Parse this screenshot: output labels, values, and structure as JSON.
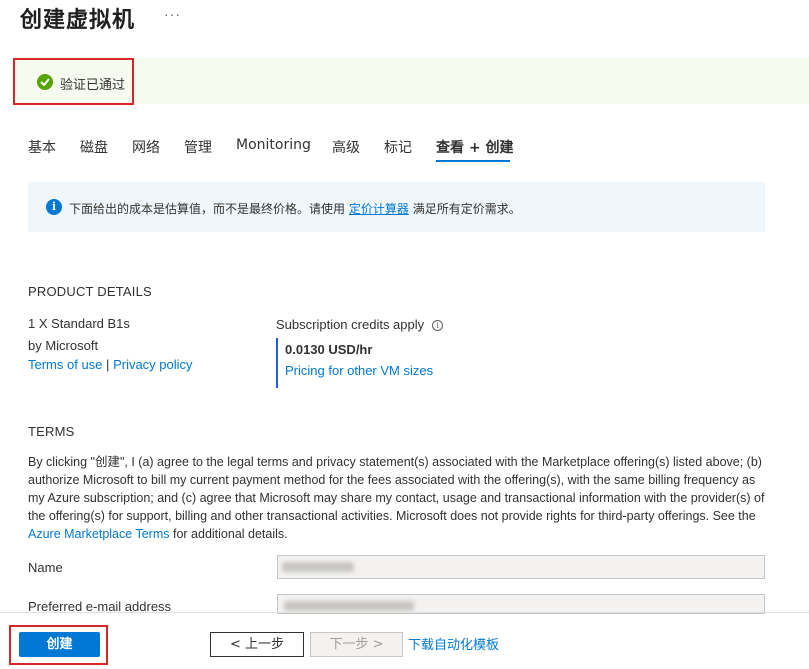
{
  "page": {
    "title": "创建虚拟机",
    "more": "···"
  },
  "validation": {
    "text": "验证已通过",
    "status_color": "#57a300",
    "icon": "check-circle-icon"
  },
  "tabs": [
    {
      "label": "基本"
    },
    {
      "label": "磁盘"
    },
    {
      "label": "网络"
    },
    {
      "label": "管理"
    },
    {
      "label": "Monitoring"
    },
    {
      "label": "高级"
    },
    {
      "label": "标记"
    },
    {
      "label": "查看 + 创建",
      "active": true
    }
  ],
  "info": {
    "icon": "info-icon",
    "text_before": "下面给出的成本是估算值，而不是最终价格。请使用",
    "link": "定价计算器",
    "text_after": "满足所有定价需求。"
  },
  "product": {
    "heading": "PRODUCT DETAILS",
    "name": "1 X Standard B1s",
    "publisher": "by Microsoft",
    "terms_link": "Terms of use",
    "separator": "|",
    "privacy_link": "Privacy policy",
    "credits_label": "Subscription credits apply",
    "price": "0.0130 USD/hr",
    "pricing_link": "Pricing for other VM sizes"
  },
  "terms": {
    "heading": "TERMS",
    "body_before": "By clicking \"创建\", I (a) agree to the legal terms and privacy statement(s) associated with the Marketplace offering(s) listed above; (b) authorize Microsoft to bill my current payment method for the fees associated with the offering(s), with the same billing frequency as my Azure subscription; and (c) agree that Microsoft may share my contact, usage and transactional information with the provider(s) of the offering(s) for support, billing and other transactional activities. Microsoft does not provide rights for third-party offerings. See the",
    "link": "Azure Marketplace Terms",
    "body_after": "for additional details."
  },
  "fields": {
    "name_label": "Name",
    "email_label": "Preferred e-mail address"
  },
  "footer": {
    "create": "创建",
    "prev": "< 上一步",
    "next": "下一步 >",
    "download": "下载自动化模板"
  },
  "colors": {
    "accent": "#0078d4",
    "highlight_border": "#d9262b"
  }
}
